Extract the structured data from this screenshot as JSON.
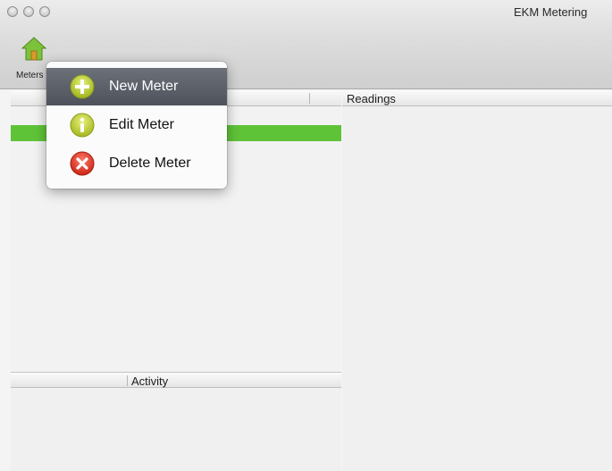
{
  "window": {
    "title": "EKM Metering"
  },
  "toolbar": {
    "meters_label": "Meters"
  },
  "panes": {
    "readings_label": "Readings",
    "activity_label": "Activity"
  },
  "menu": {
    "items": [
      {
        "label": "New Meter",
        "icon": "plus-icon",
        "highlighted": true
      },
      {
        "label": "Edit Meter",
        "icon": "info-icon",
        "highlighted": false
      },
      {
        "label": "Delete Meter",
        "icon": "delete-icon",
        "highlighted": false
      }
    ]
  },
  "colors": {
    "selection_green": "#5fc338",
    "menu_highlight": "#5a5e67"
  }
}
